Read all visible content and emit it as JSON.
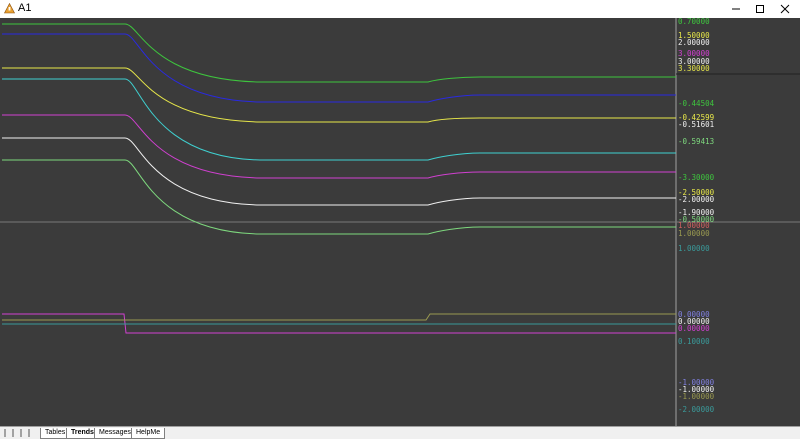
{
  "window": {
    "title": "A1"
  },
  "colors": {
    "background": "#3b3b3b",
    "green": "#3ec43e",
    "blue": "#2a2ae0",
    "yellow": "#e8e84a",
    "cyan": "#3fd0d0",
    "magenta": "#d040d0",
    "white": "#f0f0f0",
    "lightgreen": "#7ed87e",
    "teal": "#3a9a9a",
    "olive": "#9a9a50",
    "pink": "#d06060"
  },
  "axis_labels": [
    {
      "text": "0.70000",
      "color": "#3ec43e"
    },
    {
      "text": "1.50000",
      "color": "#e8e84a"
    },
    {
      "text": "2.00000",
      "color": "#f0f0f0"
    },
    {
      "text": "3.00000",
      "color": "#d040d0"
    },
    {
      "text": "3.00000",
      "color": "#f0f0f0"
    },
    {
      "text": "3.30000",
      "color": "#e8e84a"
    },
    {
      "text": "-0.44504",
      "color": "#3ec43e"
    },
    {
      "text": "-0.42599",
      "color": "#e8e84a"
    },
    {
      "text": "-0.51601",
      "color": "#f0f0f0"
    },
    {
      "text": "-0.59413",
      "color": "#7ed87e"
    },
    {
      "text": "-3.30000",
      "color": "#3ec43e"
    },
    {
      "text": "-2.50000",
      "color": "#e8e84a"
    },
    {
      "text": "-2.00000",
      "color": "#f0f0f0"
    },
    {
      "text": "-1.90000",
      "color": "#f0f0f0"
    },
    {
      "text": "-0.50000",
      "color": "#7ed87e"
    },
    {
      "text": "1.00000",
      "color": "#d06060"
    },
    {
      "text": "1.00000",
      "color": "#9a9a50"
    },
    {
      "text": "1.00000",
      "color": "#3a9a9a"
    },
    {
      "text": "0.00000",
      "color": "#8080e0"
    },
    {
      "text": "0.00000",
      "color": "#f0f0f0"
    },
    {
      "text": "0.00000",
      "color": "#d040d0"
    },
    {
      "text": "0.10000",
      "color": "#3a9a9a"
    },
    {
      "text": "-1.00000",
      "color": "#8080e0"
    },
    {
      "text": "-1.00000",
      "color": "#f0f0f0"
    },
    {
      "text": "-1.00000",
      "color": "#9a9a50"
    },
    {
      "text": "-2.00000",
      "color": "#3a9a9a"
    }
  ],
  "tabs": [
    {
      "label": "Tables",
      "active": false
    },
    {
      "label": "Trends",
      "active": true
    },
    {
      "label": "Messages",
      "active": false
    },
    {
      "label": "HelpMe",
      "active": false
    }
  ],
  "chart_data": {
    "type": "line",
    "grid": false,
    "series": [
      {
        "color": "#3ec43e",
        "values": [
          0.7,
          0.7,
          0.55,
          0.45,
          0.445,
          0.445,
          0.45,
          0.45
        ]
      },
      {
        "color": "#2a2ae0",
        "values": [
          1.0,
          1.0,
          0.6,
          0.46,
          0.45,
          0.45,
          0.52,
          0.52
        ]
      },
      {
        "color": "#e8e84a",
        "values": [
          1.5,
          1.5,
          0.7,
          0.43,
          0.425,
          0.425,
          0.44,
          0.44
        ]
      },
      {
        "color": "#3fd0d0",
        "values": [
          2.0,
          2.0,
          0.8,
          0.6,
          0.59,
          0.59,
          0.65,
          0.65
        ]
      },
      {
        "color": "#d040d0",
        "values": [
          3.0,
          3.0,
          0.9,
          0.55,
          0.52,
          0.52,
          0.56,
          0.56
        ]
      },
      {
        "color": "#f0f0f0",
        "values": [
          3.0,
          3.0,
          0.6,
          0.52,
          0.516,
          0.516,
          0.55,
          0.55
        ]
      },
      {
        "color": "#7ed87e",
        "values": [
          3.3,
          3.3,
          0.7,
          0.6,
          0.594,
          0.594,
          0.62,
          0.62
        ]
      }
    ]
  }
}
